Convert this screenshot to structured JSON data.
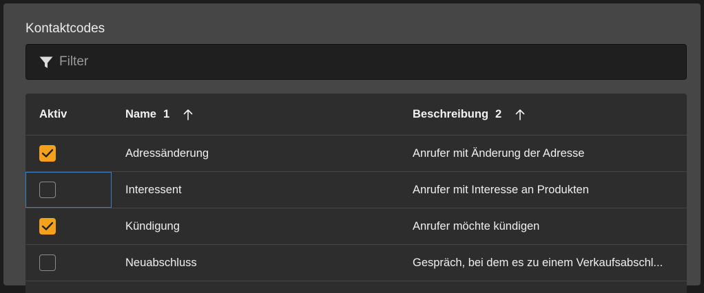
{
  "section": {
    "title": "Kontaktcodes"
  },
  "filter": {
    "placeholder": "Filter",
    "value": "",
    "icon": "filter-icon"
  },
  "grid": {
    "columns": [
      {
        "key": "active",
        "label": "Aktiv"
      },
      {
        "key": "name",
        "label": "Name",
        "sort_index": "1",
        "sort_direction": "ascending"
      },
      {
        "key": "description",
        "label": "Beschreibung",
        "sort_index": "2",
        "sort_direction": "ascending"
      }
    ],
    "rows": [
      {
        "active": true,
        "name": "Adressänderung",
        "description": "Anrufer mit Änderung der Adresse"
      },
      {
        "active": false,
        "name": "Interessent",
        "description": "Anrufer mit Interesse an Produkten",
        "focused": true
      },
      {
        "active": true,
        "name": "Kündigung",
        "description": "Anrufer möchte kündigen"
      },
      {
        "active": false,
        "name": "Neuabschluss",
        "description": "Gespräch, bei dem es zu einem Verkaufsabschl..."
      }
    ]
  },
  "colors": {
    "accent": "#f5a11c",
    "focus": "#3a7fc4",
    "panel": "#464646",
    "grid_background": "#2d2d2d"
  }
}
